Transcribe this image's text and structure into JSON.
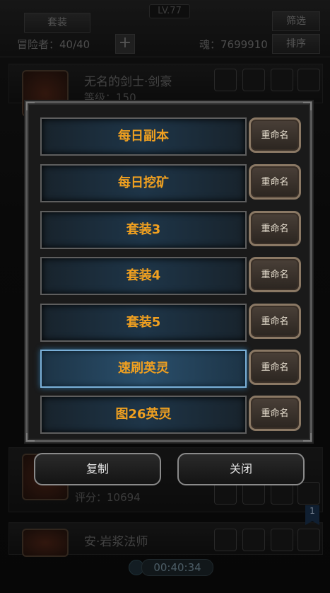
{
  "header": {
    "level": "LV.77",
    "suit_tab": "套装",
    "filter": "筛选",
    "adventurers": "冒险者：40/40",
    "soul": "魂：7699910",
    "sort": "排序"
  },
  "heroes": [
    {
      "name": "无名的剑士·剑豪",
      "sub": "等级：150"
    },
    {
      "name": "安·岩浆法师"
    }
  ],
  "score_line": "评分：10694",
  "suit_dialog": {
    "rows": [
      {
        "label": "每日副本",
        "rename": "重命名"
      },
      {
        "label": "每日挖矿",
        "rename": "重命名"
      },
      {
        "label": "套装3",
        "rename": "重命名"
      },
      {
        "label": "套装4",
        "rename": "重命名"
      },
      {
        "label": "套装5",
        "rename": "重命名"
      },
      {
        "label": "速刷英灵",
        "rename": "重命名"
      },
      {
        "label": "图26英灵",
        "rename": "重命名"
      }
    ],
    "copy": "复制",
    "close": "关闭"
  },
  "footer": {
    "timer": "00:40:34",
    "page": "1"
  },
  "colors": {
    "accent_text": "#f0a020",
    "selected_border": "#7ab0d8"
  }
}
